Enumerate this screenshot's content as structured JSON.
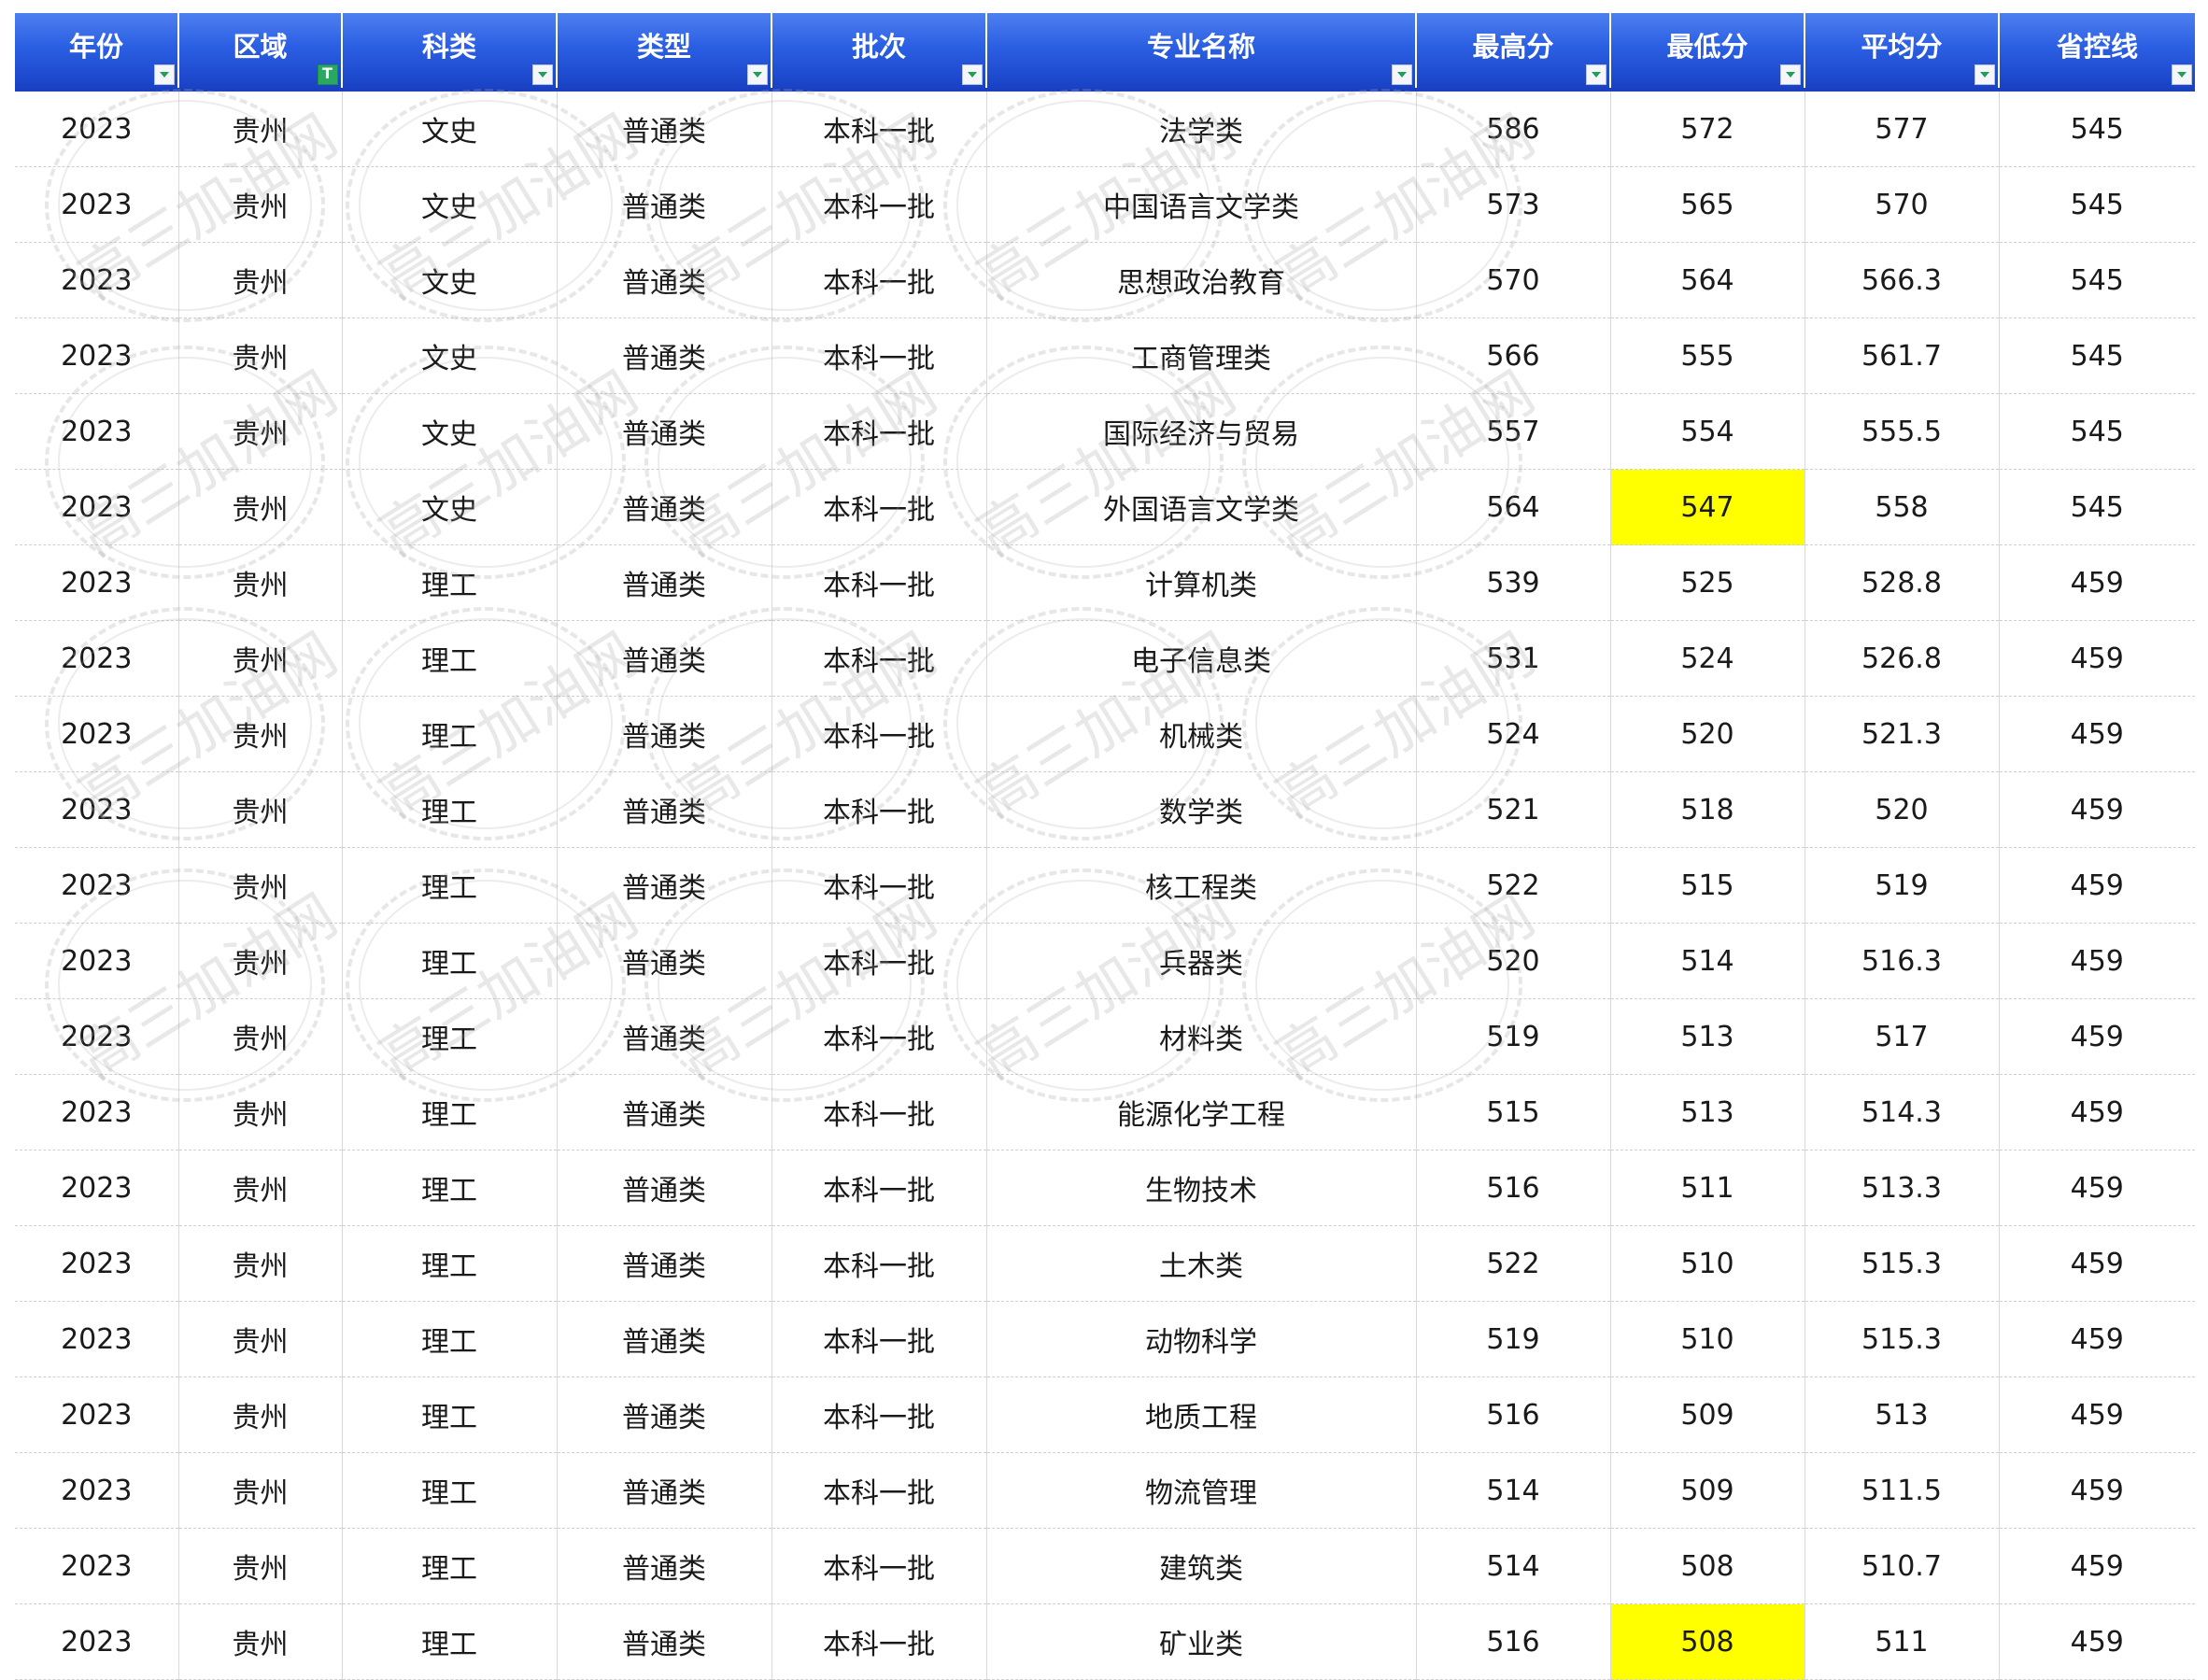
{
  "headers": [
    "年份",
    "区域",
    "科类",
    "类型",
    "批次",
    "专业名称",
    "最高分",
    "最低分",
    "平均分",
    "省控线"
  ],
  "filter": {
    "icon": "dropdown-arrow-icon",
    "active_icon": "filter-active-icon",
    "active_column": 1,
    "active_color": "#2aa85f"
  },
  "colors": {
    "header_blue": "#2b5fe3",
    "highlight_yellow": "#ffff00"
  },
  "watermark": {
    "text": "高三加油网",
    "icon": "watermark-seal-icon"
  },
  "rows": [
    {
      "cells": [
        "2023",
        "贵州",
        "文史",
        "普通类",
        "本科一批",
        "法学类",
        "586",
        "572",
        "577",
        "545"
      ],
      "highlight": false
    },
    {
      "cells": [
        "2023",
        "贵州",
        "文史",
        "普通类",
        "本科一批",
        "中国语言文学类",
        "573",
        "565",
        "570",
        "545"
      ],
      "highlight": false
    },
    {
      "cells": [
        "2023",
        "贵州",
        "文史",
        "普通类",
        "本科一批",
        "思想政治教育",
        "570",
        "564",
        "566.3",
        "545"
      ],
      "highlight": false
    },
    {
      "cells": [
        "2023",
        "贵州",
        "文史",
        "普通类",
        "本科一批",
        "工商管理类",
        "566",
        "555",
        "561.7",
        "545"
      ],
      "highlight": false
    },
    {
      "cells": [
        "2023",
        "贵州",
        "文史",
        "普通类",
        "本科一批",
        "国际经济与贸易",
        "557",
        "554",
        "555.5",
        "545"
      ],
      "highlight": false
    },
    {
      "cells": [
        "2023",
        "贵州",
        "文史",
        "普通类",
        "本科一批",
        "外国语言文学类",
        "564",
        "547",
        "558",
        "545"
      ],
      "highlight": true
    },
    {
      "cells": [
        "2023",
        "贵州",
        "理工",
        "普通类",
        "本科一批",
        "计算机类",
        "539",
        "525",
        "528.8",
        "459"
      ],
      "highlight": false
    },
    {
      "cells": [
        "2023",
        "贵州",
        "理工",
        "普通类",
        "本科一批",
        "电子信息类",
        "531",
        "524",
        "526.8",
        "459"
      ],
      "highlight": false
    },
    {
      "cells": [
        "2023",
        "贵州",
        "理工",
        "普通类",
        "本科一批",
        "机械类",
        "524",
        "520",
        "521.3",
        "459"
      ],
      "highlight": false
    },
    {
      "cells": [
        "2023",
        "贵州",
        "理工",
        "普通类",
        "本科一批",
        "数学类",
        "521",
        "518",
        "520",
        "459"
      ],
      "highlight": false
    },
    {
      "cells": [
        "2023",
        "贵州",
        "理工",
        "普通类",
        "本科一批",
        "核工程类",
        "522",
        "515",
        "519",
        "459"
      ],
      "highlight": false
    },
    {
      "cells": [
        "2023",
        "贵州",
        "理工",
        "普通类",
        "本科一批",
        "兵器类",
        "520",
        "514",
        "516.3",
        "459"
      ],
      "highlight": false
    },
    {
      "cells": [
        "2023",
        "贵州",
        "理工",
        "普通类",
        "本科一批",
        "材料类",
        "519",
        "513",
        "517",
        "459"
      ],
      "highlight": false
    },
    {
      "cells": [
        "2023",
        "贵州",
        "理工",
        "普通类",
        "本科一批",
        "能源化学工程",
        "515",
        "513",
        "514.3",
        "459"
      ],
      "highlight": false
    },
    {
      "cells": [
        "2023",
        "贵州",
        "理工",
        "普通类",
        "本科一批",
        "生物技术",
        "516",
        "511",
        "513.3",
        "459"
      ],
      "highlight": false
    },
    {
      "cells": [
        "2023",
        "贵州",
        "理工",
        "普通类",
        "本科一批",
        "土木类",
        "522",
        "510",
        "515.3",
        "459"
      ],
      "highlight": false
    },
    {
      "cells": [
        "2023",
        "贵州",
        "理工",
        "普通类",
        "本科一批",
        "动物科学",
        "519",
        "510",
        "515.3",
        "459"
      ],
      "highlight": false
    },
    {
      "cells": [
        "2023",
        "贵州",
        "理工",
        "普通类",
        "本科一批",
        "地质工程",
        "516",
        "509",
        "513",
        "459"
      ],
      "highlight": false
    },
    {
      "cells": [
        "2023",
        "贵州",
        "理工",
        "普通类",
        "本科一批",
        "物流管理",
        "514",
        "509",
        "511.5",
        "459"
      ],
      "highlight": false
    },
    {
      "cells": [
        "2023",
        "贵州",
        "理工",
        "普通类",
        "本科一批",
        "建筑类",
        "514",
        "508",
        "510.7",
        "459"
      ],
      "highlight": false
    },
    {
      "cells": [
        "2023",
        "贵州",
        "理工",
        "普通类",
        "本科一批",
        "矿业类",
        "516",
        "508",
        "511",
        "459"
      ],
      "highlight": true
    }
  ]
}
